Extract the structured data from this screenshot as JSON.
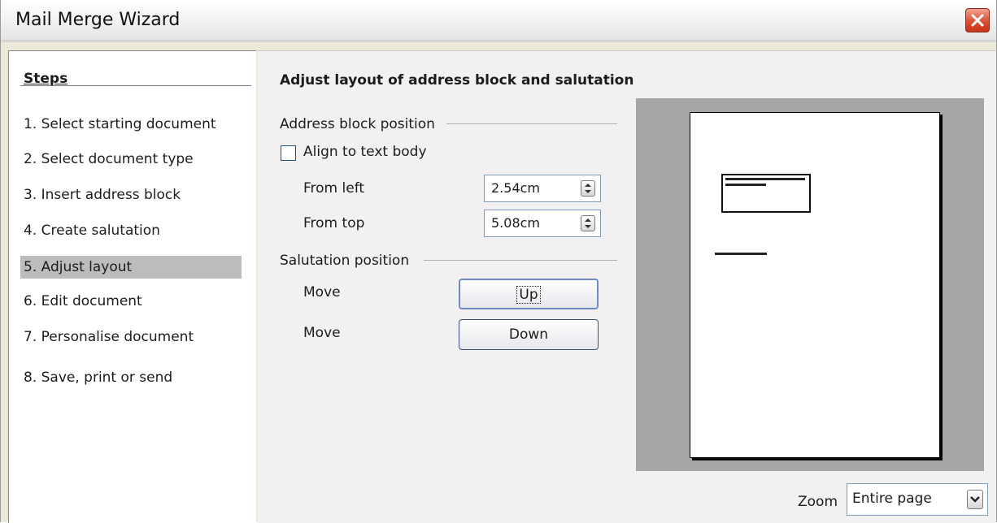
{
  "window": {
    "title": "Mail Merge Wizard"
  },
  "steps": {
    "heading": "Steps",
    "items": [
      {
        "label": "1.  Select starting document"
      },
      {
        "label": "2.  Select document type"
      },
      {
        "label": "3.  Insert address block"
      },
      {
        "label": "4.  Create salutation"
      },
      {
        "label": "5.  Adjust layout",
        "selected": true
      },
      {
        "label": "6.  Edit document"
      },
      {
        "label": "7.  Personalise document"
      },
      {
        "label": "8.  Save, print or send"
      }
    ]
  },
  "main": {
    "heading": "Adjust layout of address block and salutation",
    "address_group": {
      "title": "Address block position",
      "align_label": "Align to text body",
      "align_checked": false,
      "from_left_label": "From left",
      "from_left_value": "2.54cm",
      "from_top_label": "From top",
      "from_top_value": "5.08cm"
    },
    "salutation_group": {
      "title": "Salutation position",
      "move_label_1": "Move",
      "up_button": "Up",
      "move_label_2": "Move",
      "down_button": "Down"
    },
    "zoom": {
      "label": "Zoom",
      "value": "Entire page"
    }
  }
}
